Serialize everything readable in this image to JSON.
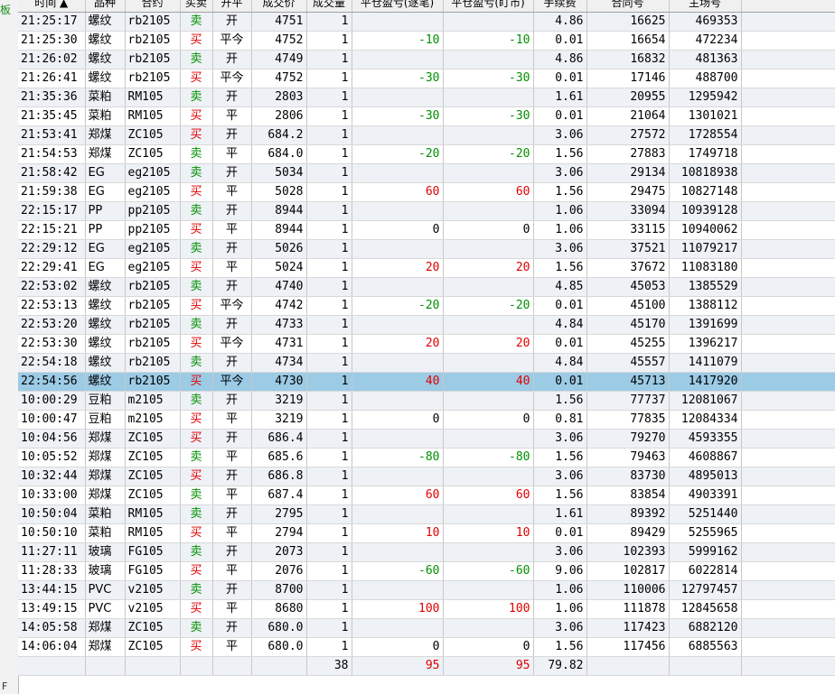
{
  "side_label": "板",
  "side_bottom": "F",
  "headers": [
    "时间 ▲",
    "品种",
    "合约",
    "买卖",
    "开平",
    "成交价",
    "成交量",
    "平仓盈亏(逐笔)",
    "平仓盈亏(盯市)",
    "手续费",
    "合同号",
    "主场号"
  ],
  "rows": [
    {
      "time": "21:25:17",
      "variety": "螺纹",
      "contract": "rb2105",
      "side": "卖",
      "oc": "开",
      "price": "4751",
      "qty": "1",
      "pnl_trade": "",
      "pnl_mtm": "",
      "fee": "4.86",
      "contract_no": "16625",
      "main_no": "469353"
    },
    {
      "time": "21:25:30",
      "variety": "螺纹",
      "contract": "rb2105",
      "side": "买",
      "oc": "平今",
      "price": "4752",
      "qty": "1",
      "pnl_trade": "-10",
      "pnl_mtm": "-10",
      "fee": "0.01",
      "contract_no": "16654",
      "main_no": "472234"
    },
    {
      "time": "21:26:02",
      "variety": "螺纹",
      "contract": "rb2105",
      "side": "卖",
      "oc": "开",
      "price": "4749",
      "qty": "1",
      "pnl_trade": "",
      "pnl_mtm": "",
      "fee": "4.86",
      "contract_no": "16832",
      "main_no": "481363"
    },
    {
      "time": "21:26:41",
      "variety": "螺纹",
      "contract": "rb2105",
      "side": "买",
      "oc": "平今",
      "price": "4752",
      "qty": "1",
      "pnl_trade": "-30",
      "pnl_mtm": "-30",
      "fee": "0.01",
      "contract_no": "17146",
      "main_no": "488700"
    },
    {
      "time": "21:35:36",
      "variety": "菜粕",
      "contract": "RM105",
      "side": "卖",
      "oc": "开",
      "price": "2803",
      "qty": "1",
      "pnl_trade": "",
      "pnl_mtm": "",
      "fee": "1.61",
      "contract_no": "20955",
      "main_no": "1295942"
    },
    {
      "time": "21:35:45",
      "variety": "菜粕",
      "contract": "RM105",
      "side": "买",
      "oc": "平",
      "price": "2806",
      "qty": "1",
      "pnl_trade": "-30",
      "pnl_mtm": "-30",
      "fee": "0.01",
      "contract_no": "21064",
      "main_no": "1301021"
    },
    {
      "time": "21:53:41",
      "variety": "郑煤",
      "contract": "ZC105",
      "side": "买",
      "oc": "开",
      "price": "684.2",
      "qty": "1",
      "pnl_trade": "",
      "pnl_mtm": "",
      "fee": "3.06",
      "contract_no": "27572",
      "main_no": "1728554"
    },
    {
      "time": "21:54:53",
      "variety": "郑煤",
      "contract": "ZC105",
      "side": "卖",
      "oc": "平",
      "price": "684.0",
      "qty": "1",
      "pnl_trade": "-20",
      "pnl_mtm": "-20",
      "fee": "1.56",
      "contract_no": "27883",
      "main_no": "1749718"
    },
    {
      "time": "21:58:42",
      "variety": "EG",
      "contract": "eg2105",
      "side": "卖",
      "oc": "开",
      "price": "5034",
      "qty": "1",
      "pnl_trade": "",
      "pnl_mtm": "",
      "fee": "3.06",
      "contract_no": "29134",
      "main_no": "10818938"
    },
    {
      "time": "21:59:38",
      "variety": "EG",
      "contract": "eg2105",
      "side": "买",
      "oc": "平",
      "price": "5028",
      "qty": "1",
      "pnl_trade": "60",
      "pnl_mtm": "60",
      "fee": "1.56",
      "contract_no": "29475",
      "main_no": "10827148"
    },
    {
      "time": "22:15:17",
      "variety": "PP",
      "contract": "pp2105",
      "side": "卖",
      "oc": "开",
      "price": "8944",
      "qty": "1",
      "pnl_trade": "",
      "pnl_mtm": "",
      "fee": "1.06",
      "contract_no": "33094",
      "main_no": "10939128"
    },
    {
      "time": "22:15:21",
      "variety": "PP",
      "contract": "pp2105",
      "side": "买",
      "oc": "平",
      "price": "8944",
      "qty": "1",
      "pnl_trade": "0",
      "pnl_mtm": "0",
      "fee": "1.06",
      "contract_no": "33115",
      "main_no": "10940062"
    },
    {
      "time": "22:29:12",
      "variety": "EG",
      "contract": "eg2105",
      "side": "卖",
      "oc": "开",
      "price": "5026",
      "qty": "1",
      "pnl_trade": "",
      "pnl_mtm": "",
      "fee": "3.06",
      "contract_no": "37521",
      "main_no": "11079217"
    },
    {
      "time": "22:29:41",
      "variety": "EG",
      "contract": "eg2105",
      "side": "买",
      "oc": "平",
      "price": "5024",
      "qty": "1",
      "pnl_trade": "20",
      "pnl_mtm": "20",
      "fee": "1.56",
      "contract_no": "37672",
      "main_no": "11083180"
    },
    {
      "time": "22:53:02",
      "variety": "螺纹",
      "contract": "rb2105",
      "side": "卖",
      "oc": "开",
      "price": "4740",
      "qty": "1",
      "pnl_trade": "",
      "pnl_mtm": "",
      "fee": "4.85",
      "contract_no": "45053",
      "main_no": "1385529"
    },
    {
      "time": "22:53:13",
      "variety": "螺纹",
      "contract": "rb2105",
      "side": "买",
      "oc": "平今",
      "price": "4742",
      "qty": "1",
      "pnl_trade": "-20",
      "pnl_mtm": "-20",
      "fee": "0.01",
      "contract_no": "45100",
      "main_no": "1388112"
    },
    {
      "time": "22:53:20",
      "variety": "螺纹",
      "contract": "rb2105",
      "side": "卖",
      "oc": "开",
      "price": "4733",
      "qty": "1",
      "pnl_trade": "",
      "pnl_mtm": "",
      "fee": "4.84",
      "contract_no": "45170",
      "main_no": "1391699"
    },
    {
      "time": "22:53:30",
      "variety": "螺纹",
      "contract": "rb2105",
      "side": "买",
      "oc": "平今",
      "price": "4731",
      "qty": "1",
      "pnl_trade": "20",
      "pnl_mtm": "20",
      "fee": "0.01",
      "contract_no": "45255",
      "main_no": "1396217"
    },
    {
      "time": "22:54:18",
      "variety": "螺纹",
      "contract": "rb2105",
      "side": "卖",
      "oc": "开",
      "price": "4734",
      "qty": "1",
      "pnl_trade": "",
      "pnl_mtm": "",
      "fee": "4.84",
      "contract_no": "45557",
      "main_no": "1411079"
    },
    {
      "time": "22:54:56",
      "variety": "螺纹",
      "contract": "rb2105",
      "side": "买",
      "oc": "平今",
      "price": "4730",
      "qty": "1",
      "pnl_trade": "40",
      "pnl_mtm": "40",
      "fee": "0.01",
      "contract_no": "45713",
      "main_no": "1417920",
      "selected": true
    },
    {
      "time": "10:00:29",
      "variety": "豆粕",
      "contract": "m2105",
      "side": "卖",
      "oc": "开",
      "price": "3219",
      "qty": "1",
      "pnl_trade": "",
      "pnl_mtm": "",
      "fee": "1.56",
      "contract_no": "77737",
      "main_no": "12081067"
    },
    {
      "time": "10:00:47",
      "variety": "豆粕",
      "contract": "m2105",
      "side": "买",
      "oc": "平",
      "price": "3219",
      "qty": "1",
      "pnl_trade": "0",
      "pnl_mtm": "0",
      "fee": "0.81",
      "contract_no": "77835",
      "main_no": "12084334"
    },
    {
      "time": "10:04:56",
      "variety": "郑煤",
      "contract": "ZC105",
      "side": "买",
      "oc": "开",
      "price": "686.4",
      "qty": "1",
      "pnl_trade": "",
      "pnl_mtm": "",
      "fee": "3.06",
      "contract_no": "79270",
      "main_no": "4593355"
    },
    {
      "time": "10:05:52",
      "variety": "郑煤",
      "contract": "ZC105",
      "side": "卖",
      "oc": "平",
      "price": "685.6",
      "qty": "1",
      "pnl_trade": "-80",
      "pnl_mtm": "-80",
      "fee": "1.56",
      "contract_no": "79463",
      "main_no": "4608867"
    },
    {
      "time": "10:32:44",
      "variety": "郑煤",
      "contract": "ZC105",
      "side": "买",
      "oc": "开",
      "price": "686.8",
      "qty": "1",
      "pnl_trade": "",
      "pnl_mtm": "",
      "fee": "3.06",
      "contract_no": "83730",
      "main_no": "4895013"
    },
    {
      "time": "10:33:00",
      "variety": "郑煤",
      "contract": "ZC105",
      "side": "卖",
      "oc": "平",
      "price": "687.4",
      "qty": "1",
      "pnl_trade": "60",
      "pnl_mtm": "60",
      "fee": "1.56",
      "contract_no": "83854",
      "main_no": "4903391"
    },
    {
      "time": "10:50:04",
      "variety": "菜粕",
      "contract": "RM105",
      "side": "卖",
      "oc": "开",
      "price": "2795",
      "qty": "1",
      "pnl_trade": "",
      "pnl_mtm": "",
      "fee": "1.61",
      "contract_no": "89392",
      "main_no": "5251440"
    },
    {
      "time": "10:50:10",
      "variety": "菜粕",
      "contract": "RM105",
      "side": "买",
      "oc": "平",
      "price": "2794",
      "qty": "1",
      "pnl_trade": "10",
      "pnl_mtm": "10",
      "fee": "0.01",
      "contract_no": "89429",
      "main_no": "5255965"
    },
    {
      "time": "11:27:11",
      "variety": "玻璃",
      "contract": "FG105",
      "side": "卖",
      "oc": "开",
      "price": "2073",
      "qty": "1",
      "pnl_trade": "",
      "pnl_mtm": "",
      "fee": "3.06",
      "contract_no": "102393",
      "main_no": "5999162"
    },
    {
      "time": "11:28:33",
      "variety": "玻璃",
      "contract": "FG105",
      "side": "买",
      "oc": "平",
      "price": "2076",
      "qty": "1",
      "pnl_trade": "-60",
      "pnl_mtm": "-60",
      "fee": "9.06",
      "contract_no": "102817",
      "main_no": "6022814"
    },
    {
      "time": "13:44:15",
      "variety": "PVC",
      "contract": "v2105",
      "side": "卖",
      "oc": "开",
      "price": "8700",
      "qty": "1",
      "pnl_trade": "",
      "pnl_mtm": "",
      "fee": "1.06",
      "contract_no": "110006",
      "main_no": "12797457"
    },
    {
      "time": "13:49:15",
      "variety": "PVC",
      "contract": "v2105",
      "side": "买",
      "oc": "平",
      "price": "8680",
      "qty": "1",
      "pnl_trade": "100",
      "pnl_mtm": "100",
      "fee": "1.06",
      "contract_no": "111878",
      "main_no": "12845658"
    },
    {
      "time": "14:05:58",
      "variety": "郑煤",
      "contract": "ZC105",
      "side": "卖",
      "oc": "开",
      "price": "680.0",
      "qty": "1",
      "pnl_trade": "",
      "pnl_mtm": "",
      "fee": "3.06",
      "contract_no": "117423",
      "main_no": "6882120"
    },
    {
      "time": "14:06:04",
      "variety": "郑煤",
      "contract": "ZC105",
      "side": "买",
      "oc": "平",
      "price": "680.0",
      "qty": "1",
      "pnl_trade": "0",
      "pnl_mtm": "0",
      "fee": "1.56",
      "contract_no": "117456",
      "main_no": "6885563"
    }
  ],
  "totals": {
    "qty": "38",
    "pnl_trade": "95",
    "pnl_mtm": "95",
    "fee": "79.82"
  },
  "colors": {
    "buy": "#e00000",
    "sell": "#009000",
    "selected_row": "#9ccbe6",
    "alt_row": "#eef1f6"
  }
}
